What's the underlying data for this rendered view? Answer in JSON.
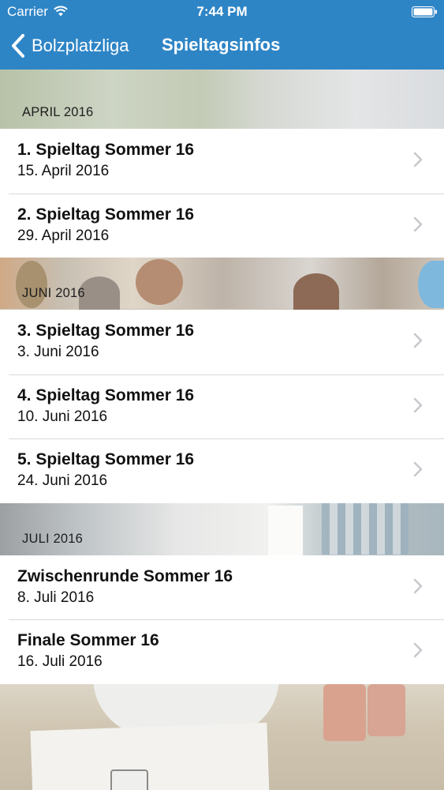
{
  "status_bar": {
    "carrier": "Carrier",
    "time": "7:44 PM",
    "wifi_icon": "wifi-icon",
    "battery_icon": "battery-icon"
  },
  "nav": {
    "back_label": "Bolzplatzliga",
    "back_icon": "chevron-left-icon",
    "title": "Spieltagsinfos",
    "bar_color": "#2e85c6"
  },
  "sections": [
    {
      "header": "APRIL 2016",
      "rows": [
        {
          "title": "1. Spieltag Sommer 16",
          "date": "15. April 2016"
        },
        {
          "title": "2. Spieltag Sommer 16",
          "date": "29. April 2016"
        }
      ]
    },
    {
      "header": "JUNI 2016",
      "rows": [
        {
          "title": "3. Spieltag Sommer 16",
          "date": "3. Juni 2016"
        },
        {
          "title": "4. Spieltag Sommer 16",
          "date": "10. Juni 2016"
        },
        {
          "title": "5. Spieltag Sommer 16",
          "date": "24. Juni 2016"
        }
      ]
    },
    {
      "header": "JULI 2016",
      "rows": [
        {
          "title": "Zwischenrunde Sommer 16",
          "date": "8. Juli 2016"
        },
        {
          "title": "Finale Sommer 16",
          "date": "16. Juli 2016"
        }
      ]
    }
  ],
  "row_icon": "chevron-right-icon"
}
